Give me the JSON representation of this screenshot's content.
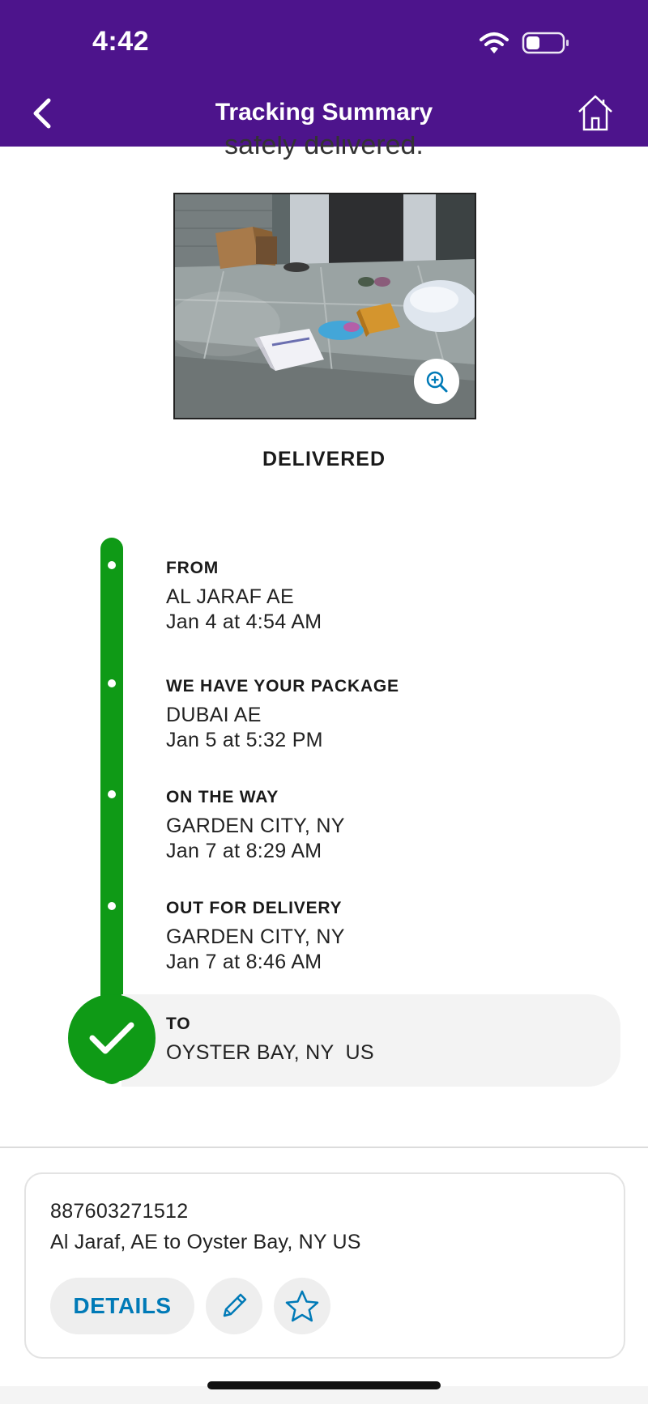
{
  "status_bar": {
    "time": "4:42"
  },
  "nav": {
    "title": "Tracking Summary",
    "back_icon": "chevron-left-icon",
    "home_icon": "home-icon"
  },
  "intro": {
    "text": "safely delivered."
  },
  "photo": {
    "description": "delivery photo of packages on porch",
    "zoom_icon": "zoom-in-icon"
  },
  "status": {
    "label": "DELIVERED"
  },
  "timeline": {
    "color": "#0f9a16",
    "events": [
      {
        "title": "FROM",
        "line1": "AL JARAF AE",
        "line2": "Jan 4 at 4:54 AM"
      },
      {
        "title": "WE HAVE YOUR PACKAGE",
        "line1": "DUBAI AE",
        "line2": "Jan 5 at 5:32 PM"
      },
      {
        "title": "ON THE WAY",
        "line1": "GARDEN CITY, NY",
        "line2": "Jan 7 at 8:29 AM"
      },
      {
        "title": "OUT FOR DELIVERY",
        "line1": "GARDEN CITY, NY",
        "line2": "Jan 7 at 8:46 AM"
      },
      {
        "title": "TO",
        "line1": "OYSTER BAY, NY  US"
      }
    ]
  },
  "summary_card": {
    "tracking_number": "887603271512",
    "route": "Al Jaraf, AE to Oyster Bay, NY US",
    "details_label": "DETAILS",
    "edit_icon": "pencil-icon",
    "favorite_icon": "star-icon"
  },
  "colors": {
    "header": "#4d148c",
    "accent": "#007ab7",
    "timeline": "#0f9a16"
  }
}
